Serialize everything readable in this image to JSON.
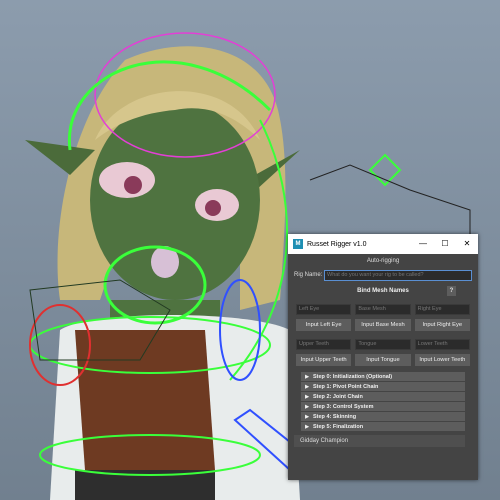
{
  "window": {
    "title": "Russet Rigger v1.0",
    "icon_letter": "M",
    "minimize_glyph": "—",
    "maximize_glyph": "☐",
    "close_glyph": "✕"
  },
  "header": {
    "subtitle": "Auto-rigging"
  },
  "rig_name": {
    "label": "Rig Name:",
    "placeholder": "What do you want your rig to be called?"
  },
  "bind_section": {
    "title": "Bind Mesh Names",
    "help_label": "?"
  },
  "mesh_fields": [
    "Left Eye",
    "Base Mesh",
    "Right Eye"
  ],
  "mesh_buttons": [
    "Input Left Eye",
    "Input Base Mesh",
    "Input Right Eye"
  ],
  "mouth_fields": [
    "Upper Teeth",
    "Tongue",
    "Lower Teeth"
  ],
  "mouth_buttons": [
    "Input Upper Teeth",
    "Input Tongue",
    "Input Lower Teeth"
  ],
  "steps": [
    "Step 0: Initialization (Optional)",
    "Step 1: Pivot Point Chain",
    "Step 2: Joint Chain",
    "Step 3: Control System",
    "Step 4: Skinning",
    "Step 5: Finalization"
  ],
  "footer": {
    "text": "Gidday Champion"
  },
  "colors": {
    "accent": "#1e8fb3",
    "panel": "#444444",
    "button": "#5d5d5d",
    "viewport": "#7d8c9c"
  }
}
